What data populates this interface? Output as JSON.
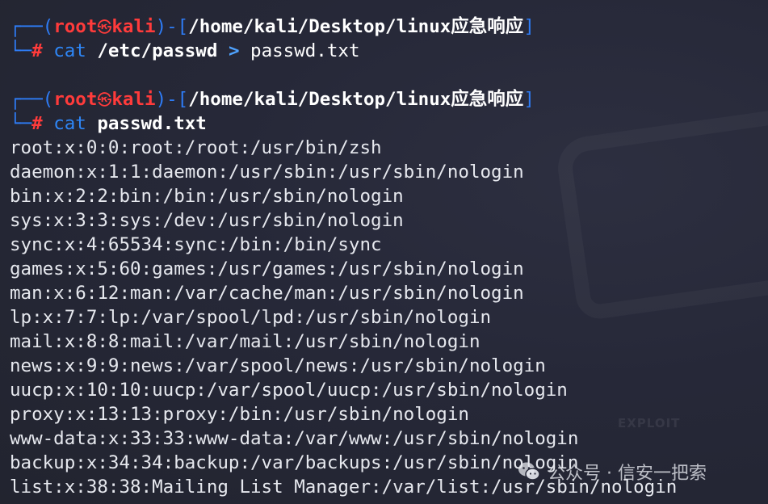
{
  "prompt": {
    "user": "root",
    "skull_glyph": "㉿",
    "host": "kali",
    "cwd": "/home/kali/Desktop/linux应急响应",
    "symbol": "#"
  },
  "commands": [
    {
      "cmd": "cat",
      "arg": "/etc/passwd",
      "redirect": ">",
      "target": "passwd.txt"
    },
    {
      "cmd": "cat",
      "arg": "passwd.txt"
    }
  ],
  "output": [
    "root:x:0:0:root:/root:/usr/bin/zsh",
    "daemon:x:1:1:daemon:/usr/sbin:/usr/sbin/nologin",
    "bin:x:2:2:bin:/bin:/usr/sbin/nologin",
    "sys:x:3:3:sys:/dev:/usr/sbin/nologin",
    "sync:x:4:65534:sync:/bin:/bin/sync",
    "games:x:5:60:games:/usr/games:/usr/sbin/nologin",
    "man:x:6:12:man:/var/cache/man:/usr/sbin/nologin",
    "lp:x:7:7:lp:/var/spool/lpd:/usr/sbin/nologin",
    "mail:x:8:8:mail:/var/mail:/usr/sbin/nologin",
    "news:x:9:9:news:/var/spool/news:/usr/sbin/nologin",
    "uucp:x:10:10:uucp:/var/spool/uucp:/usr/sbin/nologin",
    "proxy:x:13:13:proxy:/bin:/usr/sbin/nologin",
    "www-data:x:33:33:www-data:/var/www:/usr/sbin/nologin",
    "backup:x:34:34:backup:/var/backups:/usr/sbin/nologin",
    "list:x:38:38:Mailing List Manager:/var/list:/usr/sbin/nologin"
  ],
  "background": {
    "mark_text": "EXPLOIT"
  },
  "watermark": {
    "icon": "wechat-icon",
    "text": "公众号 · 信安一把索"
  },
  "colors": {
    "background": "#252837",
    "prompt_frame": "#2e7cf6",
    "prompt_user": "#ff3b3b",
    "command": "#2e86f6",
    "text": "#e6e8ee"
  }
}
